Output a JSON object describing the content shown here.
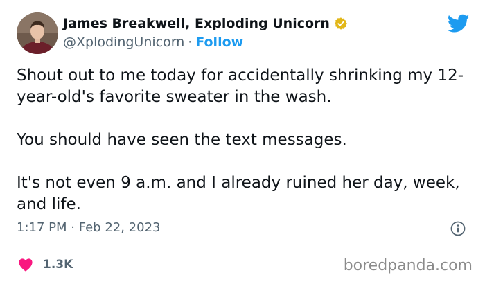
{
  "author": {
    "name": "James Breakwell, Exploding Unicorn",
    "handle": "@XplodingUnicorn",
    "separator": "·",
    "follow_label": "Follow"
  },
  "tweet": {
    "paragraphs": [
      "Shout out to me today for accidentally shrinking my 12-year-old's favorite sweater in the wash.",
      "You should have seen the text messages.",
      "It's not even 9 a.m. and I already ruined her day, week, and life."
    ],
    "time": "1:17 PM",
    "date": "Feb 22, 2023",
    "meta_separator": "·",
    "likes": "1.3K"
  },
  "icons": {
    "verified": "verified-badge-icon",
    "platform": "twitter-bird-icon",
    "info": "info-icon",
    "like": "heart-icon"
  },
  "colors": {
    "link": "#1d9bf0",
    "verified_gold": "#e2b719",
    "heart": "#f91880",
    "secondary_text": "#536471"
  },
  "watermark": "boredpanda.com"
}
